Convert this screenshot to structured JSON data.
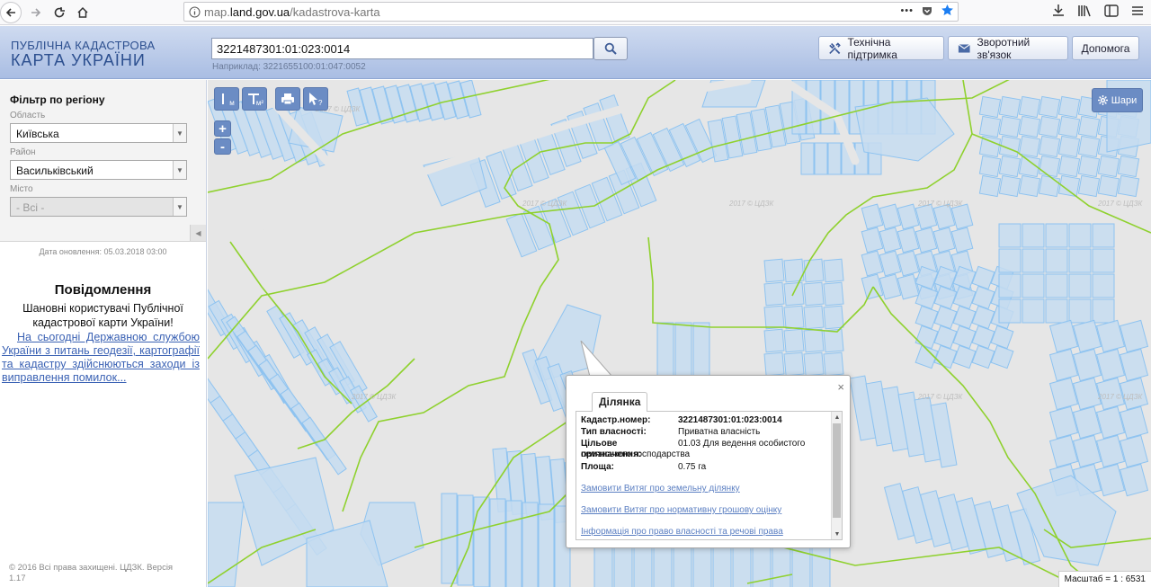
{
  "browser": {
    "url_prefix": "map.",
    "url_domain": "land.gov.ua",
    "url_path": "/kadastrova-karta",
    "menu_dots": "•••"
  },
  "header": {
    "logo_line1": "ПУБЛІЧНА КАДАСТРОВА",
    "logo_line2": "КАРТА УКРАЇНИ",
    "search_value": "3221487301:01:023:0014",
    "search_example": "Наприклад: 3221655100:01:047:0052",
    "support_label": "Технічна підтримка",
    "feedback_label": "Зворотний зв'язок",
    "help_label": "Допомога"
  },
  "sidebar": {
    "filter_title": "Фільтр по регіону",
    "oblast_label": "Область",
    "oblast_value": "Київська",
    "rayon_label": "Район",
    "rayon_value": "Васильківський",
    "city_label": "Місто",
    "city_value": "- Всі -",
    "update_date": "Дата оновлення: 05.03.2018 03:00",
    "notice_title": "Повідомлення",
    "notice_body": "Шановні користувачі Публічної кадастрової карти України!",
    "notice_link": "На сьогодні Державною службою України з питань геодезії, картографії та кадастру здійснюються заходи із виправлення помилок...",
    "copyright": "© 2016 Всі права захищені. ЦДЗК. Версія 1.17"
  },
  "map": {
    "tool_measure_line": "м",
    "tool_measure_area": "м²",
    "zoom_in": "+",
    "zoom_out": "-",
    "layers_label": "Шари",
    "scale_label": "Масштаб = 1 : 6531",
    "watermark": "2017 © ЦДЗК"
  },
  "popup": {
    "tab_label": "Ділянка",
    "close": "×",
    "rows": [
      {
        "label": "Кадастр.номер:",
        "value": "3221487301:01:023:0014"
      },
      {
        "label": "Тип власності:",
        "value": "Приватна власність"
      },
      {
        "label": "Цільове призначення:",
        "value": "01.03 Для ведення особистого селянського господарства"
      },
      {
        "label": "Площа:",
        "value": "0.75 га"
      }
    ],
    "links": [
      "Замовити Витяг про земельну ділянку",
      "Замовити Витяг про нормативну грошову оцінку",
      "Інформація про право власності та речові права"
    ]
  },
  "colors": {
    "parcel_fill": "#c6dcf0",
    "parcel_stroke": "#8ec3f0",
    "boundary": "#8fd12e",
    "map_bg": "#e6e6e6",
    "tool_btn": "#6b8cc4",
    "link": "#3b62b4"
  }
}
